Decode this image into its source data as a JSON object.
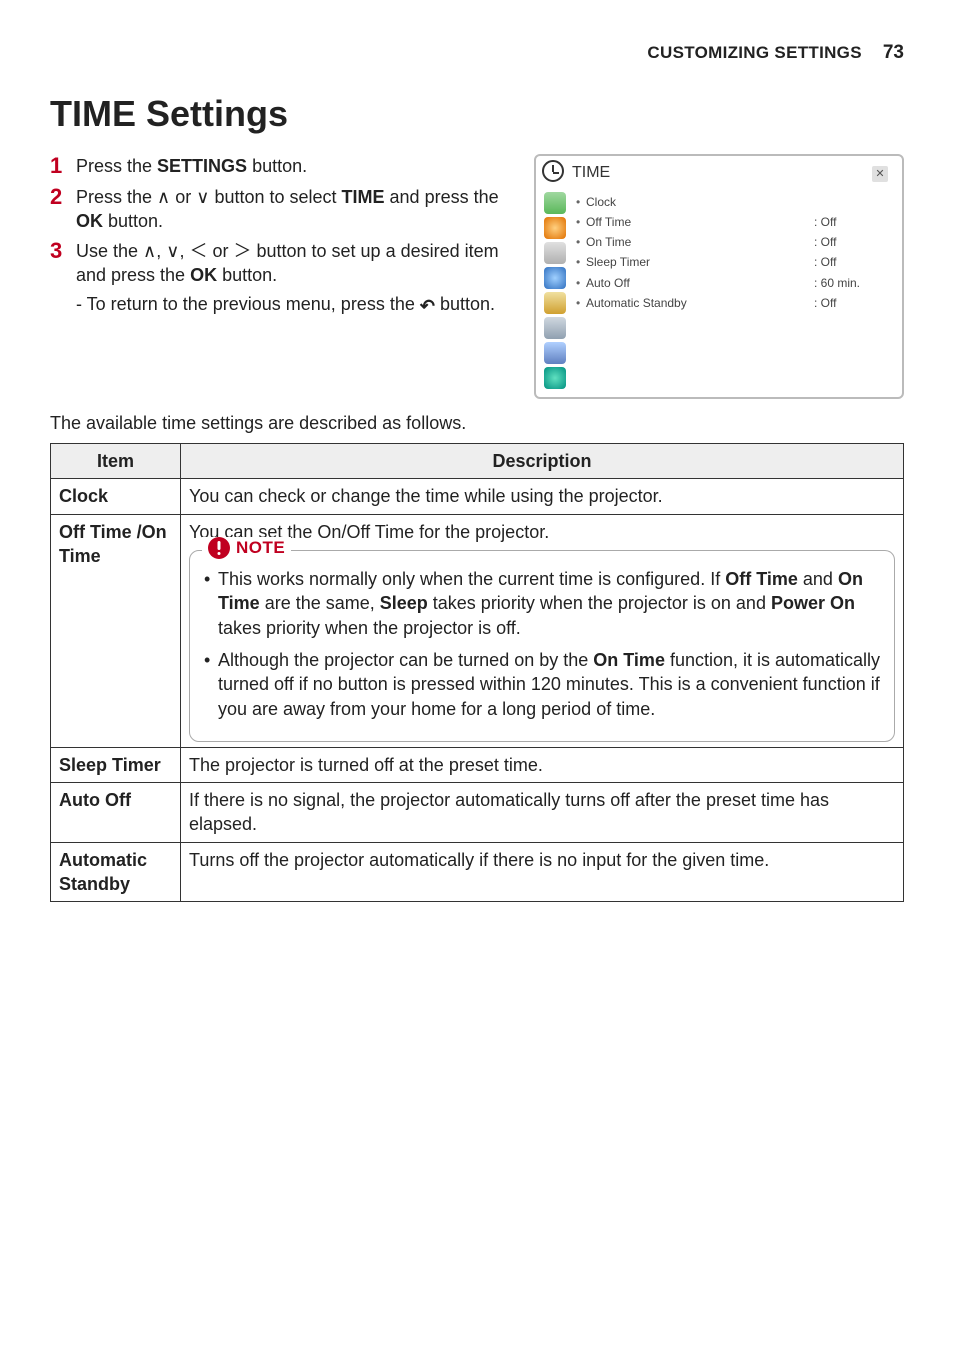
{
  "header": {
    "section": "CUSTOMIZING SETTINGS",
    "page": "73"
  },
  "title": "TIME Settings",
  "steps": {
    "s1_a": "Press the ",
    "s1_b": "SETTINGS",
    "s1_c": " button.",
    "s2_a": "Press the ",
    "s2_b": " or ",
    "s2_c": " button to select ",
    "s2_d": "TIME",
    "s2_e": " and press the ",
    "s2_f": "OK",
    "s2_g": " button.",
    "s3_a": "Use the ",
    "s3_b": " button to set up a desired item and press the ",
    "s3_c": "OK",
    "s3_d": " button.",
    "s3_sub_a": "- To return to the previous menu, press the ",
    "s3_sub_b": " button."
  },
  "sym": {
    "up": "∧",
    "down": "∨",
    "left": "＜",
    "right": "＞",
    "back": "↶",
    "sep_comma": ", ",
    "sep_or": " or "
  },
  "menu": {
    "title": "TIME",
    "close": "✕",
    "items": [
      {
        "label": "Clock",
        "value": ""
      },
      {
        "label": "Off Time",
        "value": ": Off"
      },
      {
        "label": "On Time",
        "value": ": Off"
      },
      {
        "label": "Sleep Timer",
        "value": ": Off"
      },
      {
        "label": "Auto Off",
        "value": ": 60 min."
      },
      {
        "label": "Automatic Standby",
        "value": ": Off"
      }
    ]
  },
  "intro": "The available time settings are described as follows.",
  "table": {
    "head_item": "Item",
    "head_desc": "Description",
    "rows": {
      "clock": {
        "label": "Clock",
        "desc": "You can check or change the time while using the projector."
      },
      "offon": {
        "label": "Off Time /On Time",
        "lead": "You can set the On/Off Time for the projector.",
        "note_label": "NOTE",
        "n1_a": "This works normally only when the current time is configured. If ",
        "n1_b": "Off Time",
        "n1_c": " and ",
        "n1_d": "On Time",
        "n1_e": " are the same, ",
        "n1_f": "Sleep",
        "n1_g": " takes priority when the projector is on and ",
        "n1_h": "Power On",
        "n1_i": " takes priority when the projector is off.",
        "n2_a": "Although the projector can be turned on by the ",
        "n2_b": "On Time",
        "n2_c": " function, it is automatically turned off if no button is pressed within 120 minutes. This is a convenient function if you are away from your home for a long period of time."
      },
      "sleep": {
        "label": "Sleep Timer",
        "desc": "The projector is turned off at the preset time."
      },
      "autooff": {
        "label": "Auto Off",
        "desc": "If there is no signal, the projector automatically turns off after the preset time has elapsed."
      },
      "autostby": {
        "label": "Automatic Standby",
        "desc": "Turns off the projector automatically if there is no input for the given time."
      }
    }
  }
}
